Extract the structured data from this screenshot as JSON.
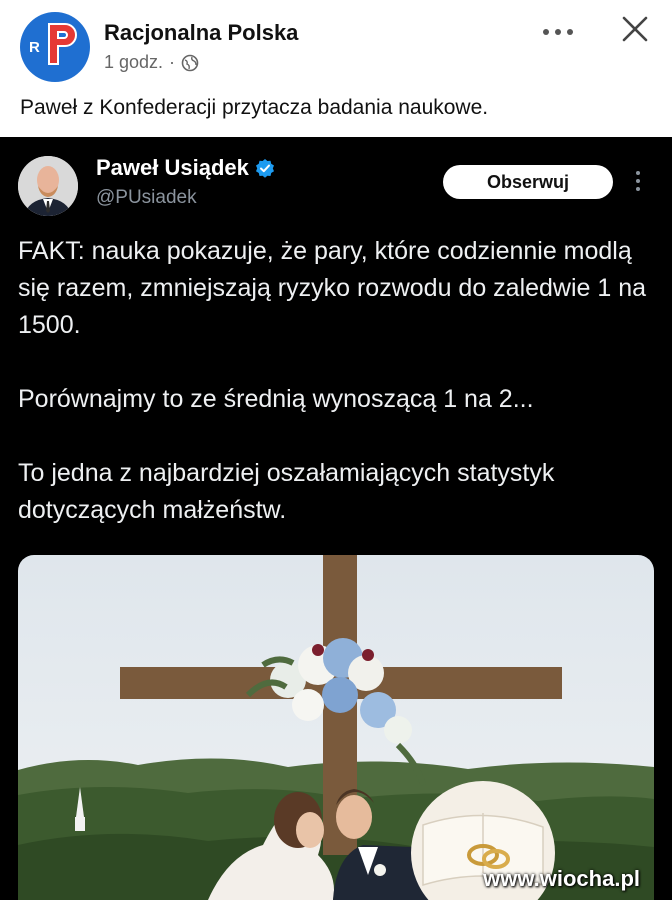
{
  "post": {
    "page_name": "Racjonalna Polska",
    "time": "1 godz.",
    "separator": "·",
    "caption": "Paweł z Konfederacji przytacza badania naukowe.",
    "more_icon": "more-horizontal-icon",
    "close_icon": "close-icon",
    "avatar_letters": "RP",
    "avatar_color": "#1f6fd1",
    "avatar_accent": "#e53935"
  },
  "tweet": {
    "name": "Paweł Usiądek",
    "handle": "@PUsiadek",
    "verified_color": "#1d9bf0",
    "follow_label": "Obserwuj",
    "paragraphs": [
      "FAKT: nauka pokazuje, że pary, które codziennie modlą się razem, zmniejszają ryzyko rozwodu do zaledwie 1 na 1500.",
      "Porównajmy to ze średnią wynoszącą 1 na 2...",
      "To jedna z najbardziej oszałamiających statystyk dotyczących małżeństw."
    ]
  },
  "watermark": "www.wiocha.pl"
}
